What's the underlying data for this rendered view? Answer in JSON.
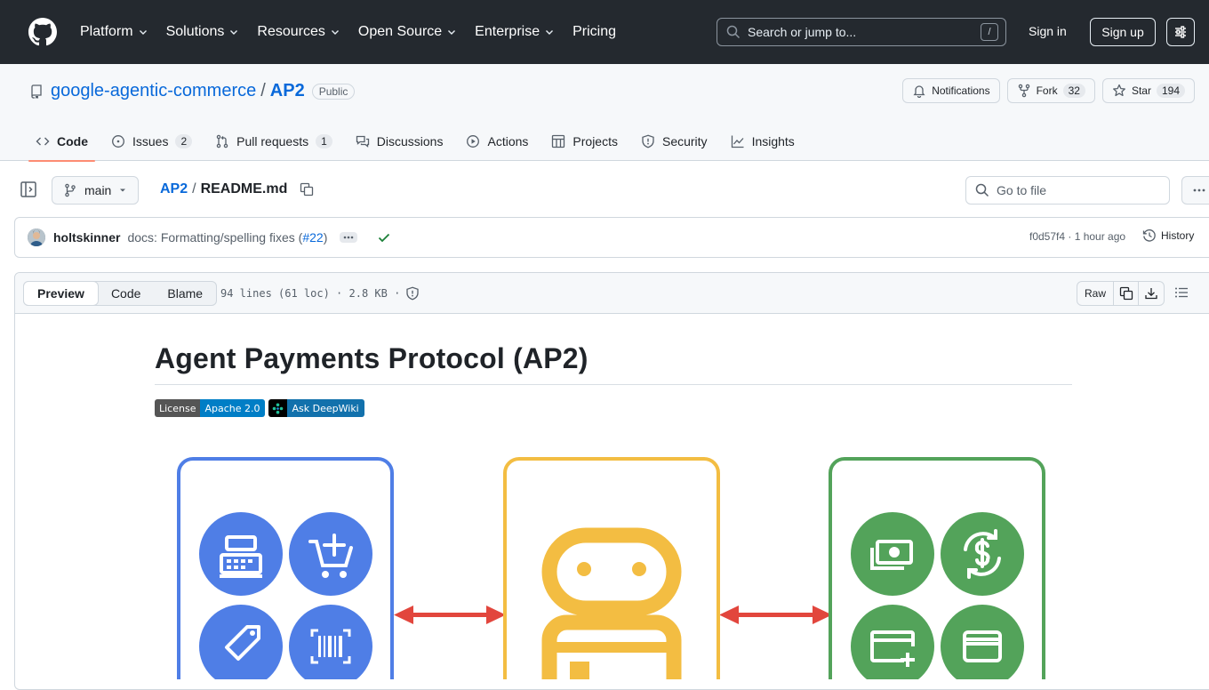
{
  "header": {
    "nav": [
      "Platform",
      "Solutions",
      "Resources",
      "Open Source",
      "Enterprise",
      "Pricing"
    ],
    "search_placeholder": "Search or jump to...",
    "search_shortcut": "/",
    "sign_in": "Sign in",
    "sign_up": "Sign up"
  },
  "repo": {
    "owner": "google-agentic-commerce",
    "separator": "/",
    "name": "AP2",
    "visibility": "Public",
    "notifications_label": "Notifications",
    "fork_label": "Fork",
    "fork_count": "32",
    "star_label": "Star",
    "star_count": "194",
    "tabs": [
      {
        "label": "Code",
        "count": ""
      },
      {
        "label": "Issues",
        "count": "2"
      },
      {
        "label": "Pull requests",
        "count": "1"
      },
      {
        "label": "Discussions",
        "count": ""
      },
      {
        "label": "Actions",
        "count": ""
      },
      {
        "label": "Projects",
        "count": ""
      },
      {
        "label": "Security",
        "count": ""
      },
      {
        "label": "Insights",
        "count": ""
      }
    ]
  },
  "file_nav": {
    "branch": "main",
    "crumb_repo": "AP2",
    "crumb_sep": "/",
    "crumb_file": "README.md",
    "goto_placeholder": "Go to file"
  },
  "commit": {
    "author": "holtskinner",
    "message": "docs: Formatting/spelling fixes (",
    "pr": "#22",
    "message_end": ")",
    "meta": "f0d57f4 · 1 hour ago",
    "history": "History"
  },
  "viewer": {
    "tabs": [
      "Preview",
      "Code",
      "Blame"
    ],
    "info": "94 lines (61 loc) · 2.8 KB ·",
    "raw": "Raw"
  },
  "readme": {
    "title": "Agent Payments Protocol (AP2)",
    "badge_license_left": "License",
    "badge_license_right": "Apache 2.0",
    "badge_deepwiki": "Ask DeepWiki"
  },
  "colors": {
    "header_bg": "#24292f",
    "link": "#0969da",
    "active_tab": "#fd8c73",
    "blue": "#4f7ee6",
    "yellow": "#f3bd42",
    "green": "#53a35a",
    "arrow": "#e2463d"
  }
}
